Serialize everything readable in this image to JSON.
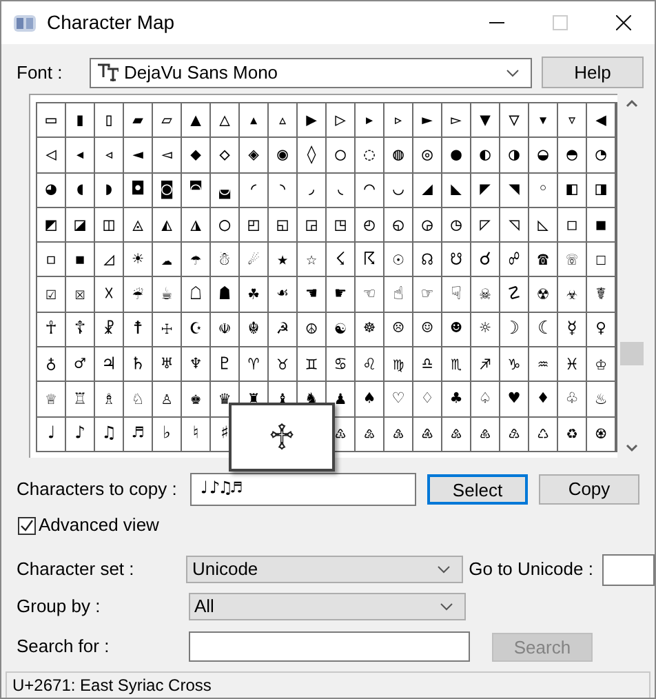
{
  "window": {
    "title": "Character Map",
    "controls": [
      {
        "kind": "minimize",
        "disabled": false
      },
      {
        "kind": "maximize",
        "disabled": true
      },
      {
        "kind": "close",
        "disabled": false
      }
    ]
  },
  "font": {
    "label": "Font :",
    "value": "DejaVu Sans Mono"
  },
  "help_button": "Help",
  "grid": {
    "rows": [
      {
        "cells": [
          "▭",
          "▮",
          "▯",
          "▰",
          "▱",
          "▲",
          "△",
          "▴",
          "▵",
          "▶",
          "▷",
          "▸",
          "▹",
          "►",
          "▻",
          "▼",
          "▽",
          "▾",
          "▿",
          "◀"
        ]
      },
      {
        "cells": [
          "◁",
          "◂",
          "◃",
          "◄",
          "◅",
          "◆",
          "◇",
          "◈",
          "◉",
          "◊",
          "○",
          "◌",
          "◍",
          "◎",
          "●",
          "◐",
          "◑",
          "◒",
          "◓",
          "◔"
        ]
      },
      {
        "cells": [
          "◕",
          "◖",
          "◗",
          "◘",
          "◙",
          "◚",
          "◛",
          "◜",
          "◝",
          "◞",
          "◟",
          "◠",
          "◡",
          "◢",
          "◣",
          "◤",
          "◥",
          "◦",
          "◧",
          "◨"
        ]
      },
      {
        "cells": [
          "◩",
          "◪",
          "◫",
          "◬",
          "◭",
          "◮",
          "◯",
          "◰",
          "◱",
          "◲",
          "◳",
          "◴",
          "◵",
          "◶",
          "◷",
          "◸",
          "◹",
          "◺",
          "◻",
          "◼"
        ]
      },
      {
        "cells": [
          "◽",
          "◾",
          "◿",
          "☀",
          "☁",
          "☂",
          "☃",
          "☄",
          "★",
          "☆",
          "☇",
          "☈",
          "☉",
          "☊",
          "☋",
          "☌",
          "☍",
          "☎",
          "☏",
          "☐"
        ]
      },
      {
        "cells": [
          "☑",
          "☒",
          "☓",
          "☔",
          "☕",
          "☖",
          "☗",
          "☘",
          "☙",
          "☚",
          "☛",
          "☜",
          "☝",
          "☞",
          "☟",
          "☠",
          "☡",
          "☢",
          "☣",
          "☤"
        ]
      },
      {
        "cells": [
          "☥",
          "☦",
          "☧",
          "☨",
          "☩",
          "☪",
          "☫",
          "☬",
          "☭",
          "☮",
          "☯",
          "☸",
          "☹",
          "☺",
          "☻",
          "☼",
          "☽",
          "☾",
          "☿",
          "♀"
        ]
      },
      {
        "cells": [
          "♁",
          "♂",
          "♃",
          "♄",
          "♅",
          "♆",
          "♇",
          "♈",
          "♉",
          "♊",
          "♋",
          "♌",
          "♍",
          "♎",
          "♏",
          "♐",
          "♑",
          "♒",
          "♓",
          "♔"
        ]
      },
      {
        "cells": [
          "♕",
          "♖",
          "♗",
          "♘",
          "♙",
          "♚",
          "♛",
          "♜",
          "♝",
          "♞",
          "♟",
          "♠",
          "♡",
          "♢",
          "♣",
          "♤",
          "♥",
          "♦",
          "♧",
          "♨"
        ]
      },
      {
        "cells": [
          "♩",
          "♪",
          "♫",
          "♬",
          "♭",
          "♮",
          "♯"
        ],
        "after_popup": [
          "♳",
          "♴",
          "♵",
          "♶",
          "♷",
          "♸",
          "♹",
          "♺",
          "♻",
          "♼"
        ]
      }
    ],
    "magnified": "♱"
  },
  "copy": {
    "label": "Characters to copy :",
    "value": "♩♪♫♬",
    "select_button": "Select",
    "select_focused": true,
    "copy_button": "Copy"
  },
  "advanced_view": {
    "label": "Advanced view",
    "checked": true
  },
  "character_set": {
    "label": "Character set :",
    "value": "Unicode"
  },
  "go_to_unicode": {
    "label": "Go to Unicode :"
  },
  "group_by": {
    "label": "Group by :",
    "value": "All"
  },
  "search": {
    "label": "Search for :",
    "button": "Search",
    "button_disabled": true
  },
  "status_bar": "U+2671: East Syriac Cross"
}
